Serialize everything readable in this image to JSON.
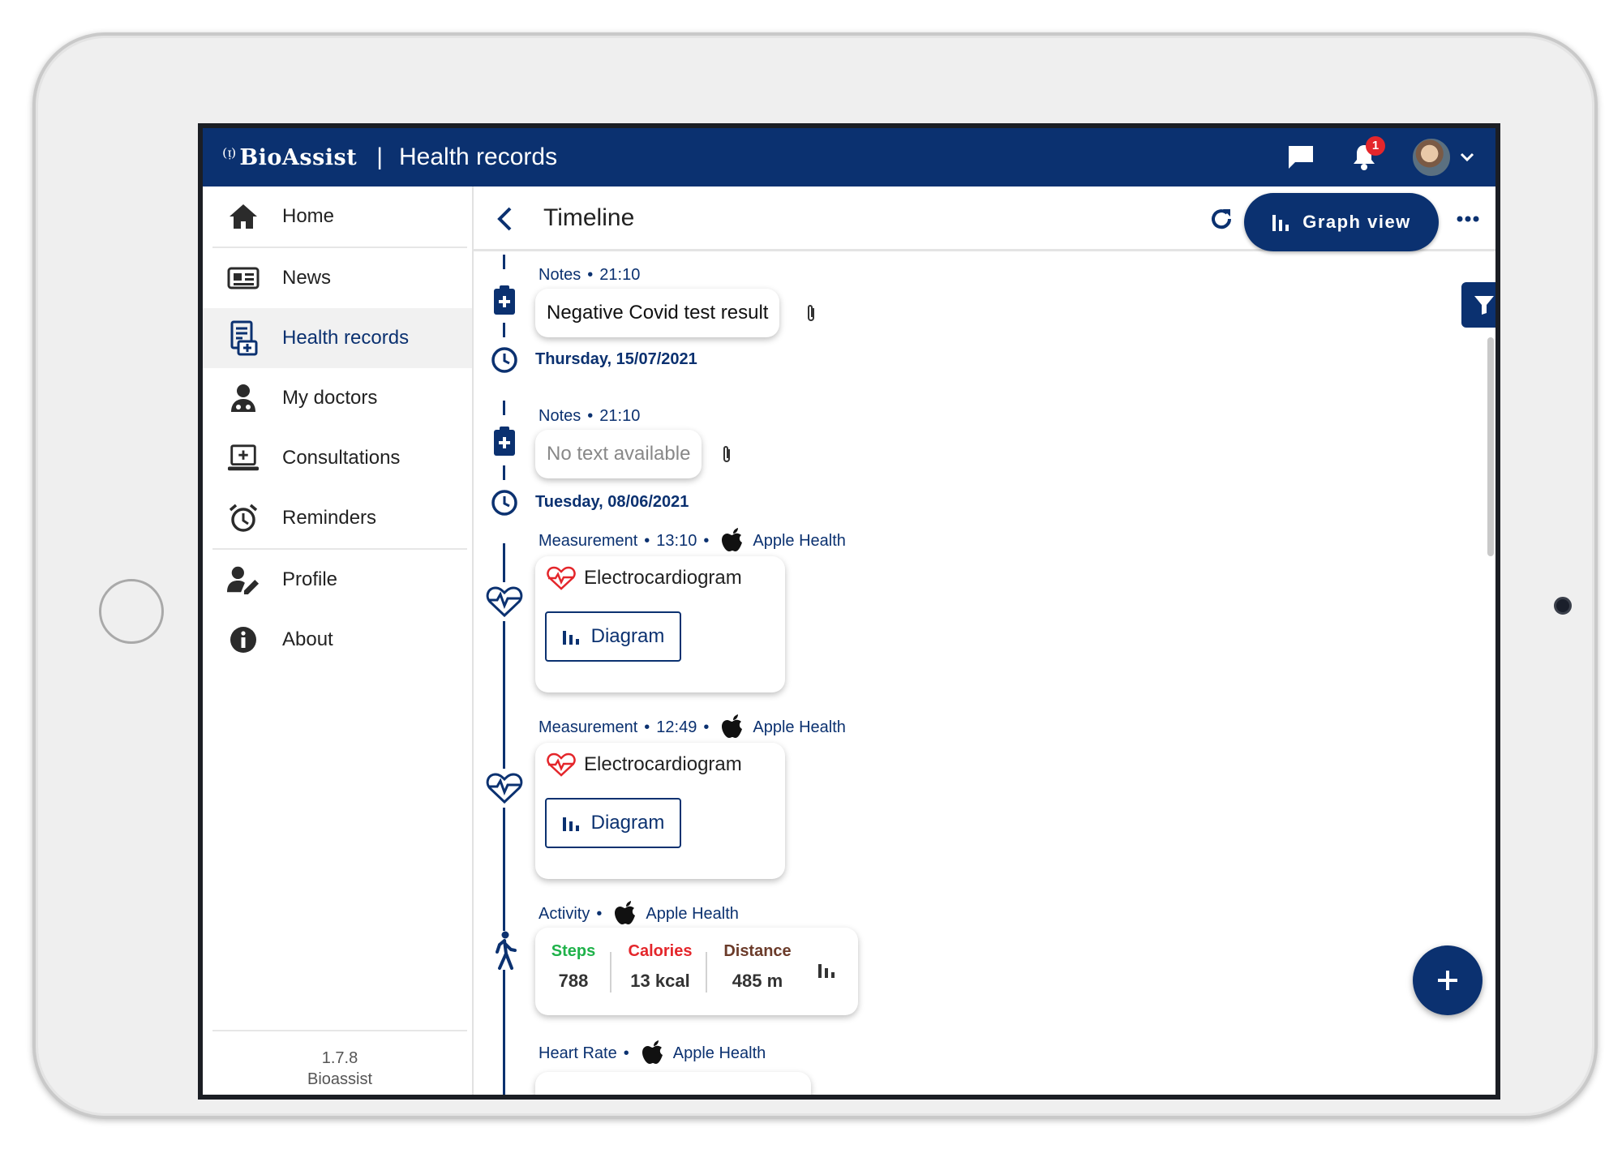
{
  "app": {
    "brand": "BioAssist",
    "page_title": "Health records",
    "notification_count": "1"
  },
  "sidebar": {
    "items": [
      {
        "label": "Home",
        "icon": "home-icon"
      },
      {
        "label": "News",
        "icon": "newspaper-icon"
      },
      {
        "label": "Health records",
        "icon": "medical-records-icon"
      },
      {
        "label": "My doctors",
        "icon": "doctor-icon"
      },
      {
        "label": "Consultations",
        "icon": "laptop-medical-icon"
      },
      {
        "label": "Reminders",
        "icon": "alarm-clock-icon"
      },
      {
        "label": "Profile",
        "icon": "user-edit-icon"
      },
      {
        "label": "About",
        "icon": "info-icon"
      }
    ],
    "active": "Health records",
    "version": "1.7.8",
    "version_name": "Bioassist"
  },
  "header": {
    "title": "Timeline",
    "graph_view_label": "Graph view"
  },
  "timeline": {
    "entries": [
      {
        "type": "Notes",
        "time": "21:10",
        "text": "Negative Covid test result"
      },
      {
        "date": "Thursday, 15/07/2021"
      },
      {
        "type": "Notes",
        "time": "21:10",
        "text": "No text available"
      },
      {
        "date": "Tuesday, 08/06/2021"
      },
      {
        "type": "Measurement",
        "time": "13:10",
        "source": "Apple Health",
        "title": "Electrocardiogram",
        "button": "Diagram"
      },
      {
        "type": "Measurement",
        "time": "12:49",
        "source": "Apple Health",
        "title": "Electrocardiogram",
        "button": "Diagram"
      },
      {
        "type": "Activity",
        "source": "Apple Health",
        "stats": [
          {
            "label": "Steps",
            "value": "788"
          },
          {
            "label": "Calories",
            "value": "13 kcal"
          },
          {
            "label": "Distance",
            "value": "485 m"
          }
        ]
      },
      {
        "type": "Heart Rate",
        "source": "Apple Health"
      }
    ],
    "separator": "•"
  },
  "colors": {
    "primary": "#0b3170",
    "steps": "#1fb24a",
    "calories": "#e4262b",
    "distance": "#6b3b2a",
    "badge": "#e4262b"
  }
}
